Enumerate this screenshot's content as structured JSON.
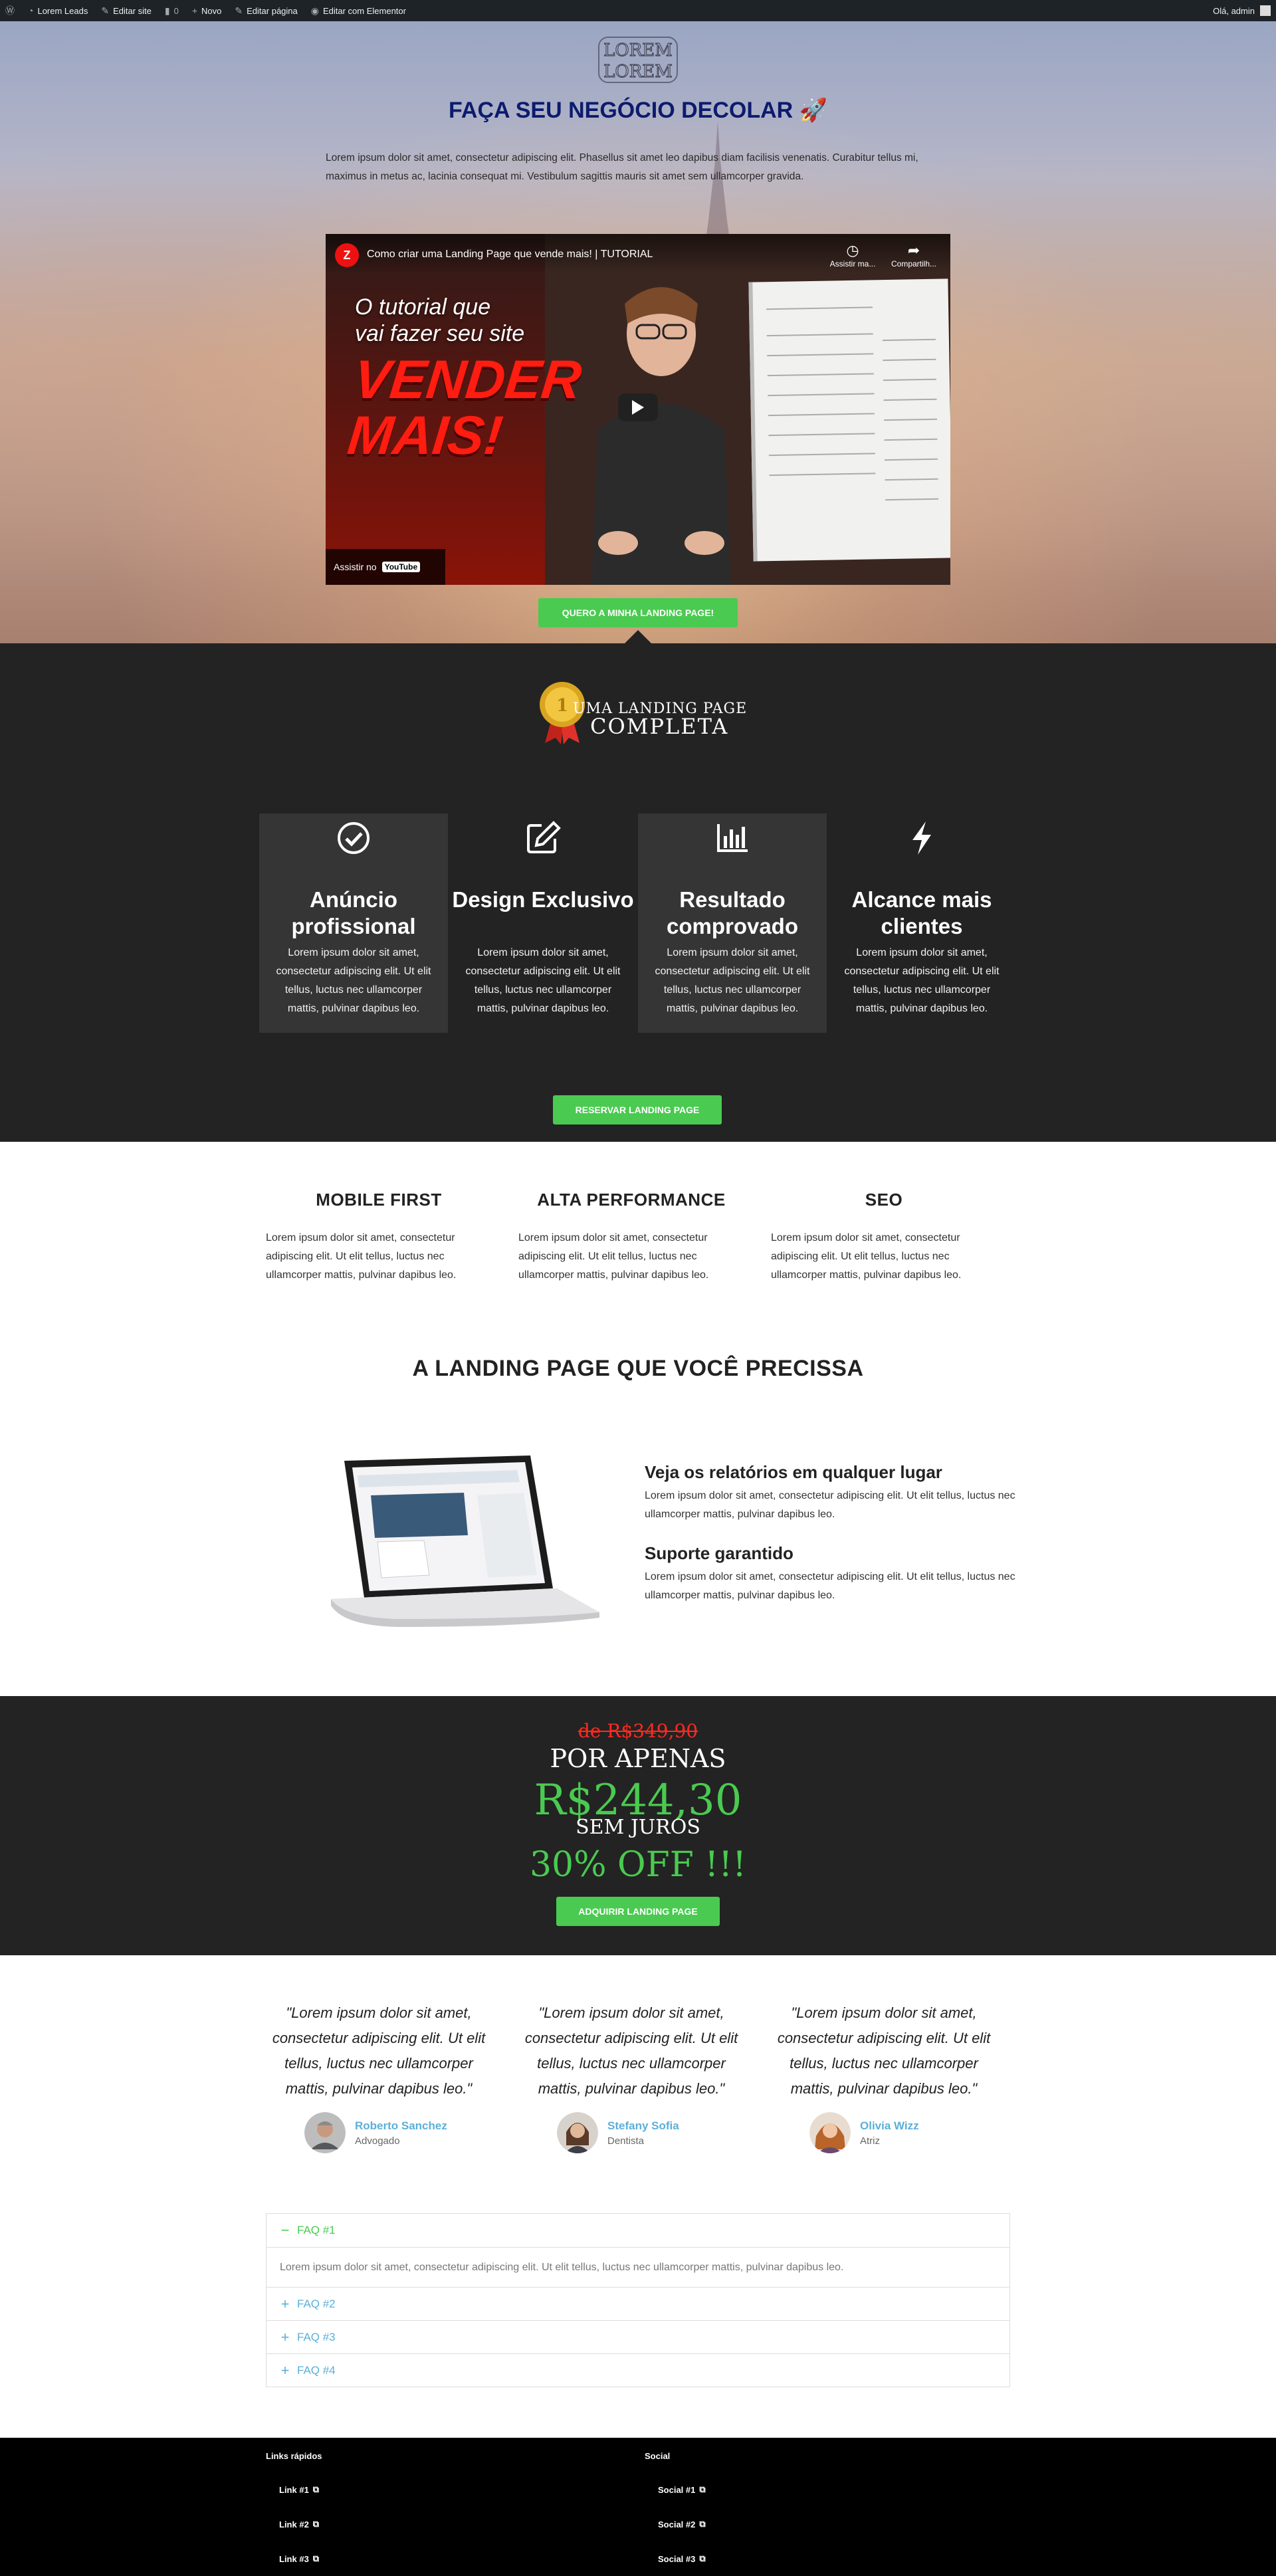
{
  "adminbar": {
    "site": "Lorem Leads",
    "edit_site": "Editar site",
    "comments": "0",
    "new": "Novo",
    "edit_page": "Editar página",
    "elementor": "Editar com Elementor",
    "greeting": "Olá, admin"
  },
  "hero": {
    "logo_top": "LOREM",
    "logo_bottom": "LOREM",
    "title": "FAÇA SEU NEGÓCIO DECOLAR 🚀",
    "text": "Lorem ipsum dolor sit amet, consectetur adipiscing elit. Phasellus sit amet leo dapibus diam facilisis venenatis. Curabitur tellus mi, maximus in metus ac, lacinia consequat mi. Vestibulum sagittis mauris sit amet sem ullamcorper gravida.",
    "video": {
      "title": "Como criar uma Landing Page que vende mais! | TUTORIAL",
      "watch_later": "Assistir ma...",
      "share": "Compartilh...",
      "overlay_line1": "O tutorial que",
      "overlay_line2": "vai fazer seu site",
      "overlay_big1": "VENDER",
      "overlay_big2": "MAIS!",
      "watch_on": "Assistir no",
      "youtube": "YouTube"
    },
    "cta": "QUERO A MINHA LANDING PAGE!"
  },
  "badge": {
    "line1": "UMA LANDING PAGE",
    "line2": "COMPLETA"
  },
  "features": [
    {
      "icon": "check-circle-icon",
      "title": "Anúncio profissional",
      "text": "Lorem ipsum dolor sit amet, consectetur adipiscing elit. Ut elit tellus, luctus nec ullamcorper mattis, pulvinar dapibus leo."
    },
    {
      "icon": "edit-icon",
      "title": "Design Exclusivo",
      "text": "Lorem ipsum dolor sit amet, consectetur adipiscing elit. Ut elit tellus, luctus nec ullamcorper mattis, pulvinar dapibus leo."
    },
    {
      "icon": "bar-chart-icon",
      "title": "Resultado comprovado",
      "text": "Lorem ipsum dolor sit amet, consectetur adipiscing elit. Ut elit tellus, luctus nec ullamcorper mattis, pulvinar dapibus leo."
    },
    {
      "icon": "bolt-icon",
      "title": "Alcance mais clientes",
      "text": "Lorem ipsum dolor sit amet, consectetur adipiscing elit. Ut elit tellus, luctus nec ullamcorper mattis, pulvinar dapibus leo."
    }
  ],
  "reserve_btn": "RESERVAR LANDING PAGE",
  "columns": [
    {
      "title": "MOBILE FIRST",
      "text": "Lorem ipsum dolor sit amet, consectetur adipiscing elit. Ut elit tellus, luctus nec ullamcorper mattis, pulvinar dapibus leo."
    },
    {
      "title": "ALTA PERFORMANCE",
      "text": "Lorem ipsum dolor sit amet, consectetur adipiscing elit. Ut elit tellus, luctus nec ullamcorper mattis, pulvinar dapibus leo."
    },
    {
      "title": "SEO",
      "text": "Lorem ipsum dolor sit amet, consectetur adipiscing elit. Ut elit tellus, luctus nec ullamcorper mattis, pulvinar dapibus leo."
    }
  ],
  "section_title": "A LANDING PAGE QUE VOCÊ PRECISSA",
  "reports": [
    {
      "title": "Veja os relatórios em qualquer lugar",
      "text": "Lorem ipsum dolor sit amet, consectetur adipiscing elit. Ut elit tellus, luctus nec ullamcorper mattis, pulvinar dapibus leo."
    },
    {
      "title": "Suporte garantido",
      "text": "Lorem ipsum dolor sit amet, consectetur adipiscing elit. Ut elit tellus, luctus nec ullamcorper mattis, pulvinar dapibus leo."
    }
  ],
  "pricing": {
    "old": "de R$349,90",
    "por": "POR APENAS",
    "new": "R$244,30",
    "sem": "SEM JUROS",
    "off": "30% OFF !!!",
    "cta": "ADQUIRIR LANDING PAGE"
  },
  "testimonials": [
    {
      "quote": "\"Lorem ipsum dolor sit amet, consectetur adipiscing elit. Ut elit tellus, luctus nec ullamcorper mattis, pulvinar dapibus leo.\"",
      "name": "Roberto Sanchez",
      "role": "Advogado"
    },
    {
      "quote": "\"Lorem ipsum dolor sit amet, consectetur adipiscing elit. Ut elit tellus, luctus nec ullamcorper mattis, pulvinar dapibus leo.\"",
      "name": "Stefany Sofia",
      "role": "Dentista"
    },
    {
      "quote": "\"Lorem ipsum dolor sit amet, consectetur adipiscing elit. Ut elit tellus, luctus nec ullamcorper mattis, pulvinar dapibus leo.\"",
      "name": "Olivia Wizz",
      "role": "Atriz"
    }
  ],
  "faq": {
    "items": [
      "FAQ #1",
      "FAQ #2",
      "FAQ #3",
      "FAQ #4"
    ],
    "open_text": "Lorem ipsum dolor sit amet, consectetur adipiscing elit. Ut elit tellus, luctus nec ullamcorper mattis, pulvinar dapibus leo."
  },
  "footer": {
    "links_title": "Links rápidos",
    "social_title": "Social",
    "links": [
      "Link #1",
      "Link #2",
      "Link #3"
    ],
    "social": [
      "Social #1",
      "Social #2",
      "Social #3"
    ]
  },
  "colors": {
    "accent_green": "#4aca50",
    "dark_bg": "#232323",
    "link_blue": "#5bafd9",
    "title_navy": "#0c1b6e",
    "strike_red": "#ff2a1f"
  }
}
